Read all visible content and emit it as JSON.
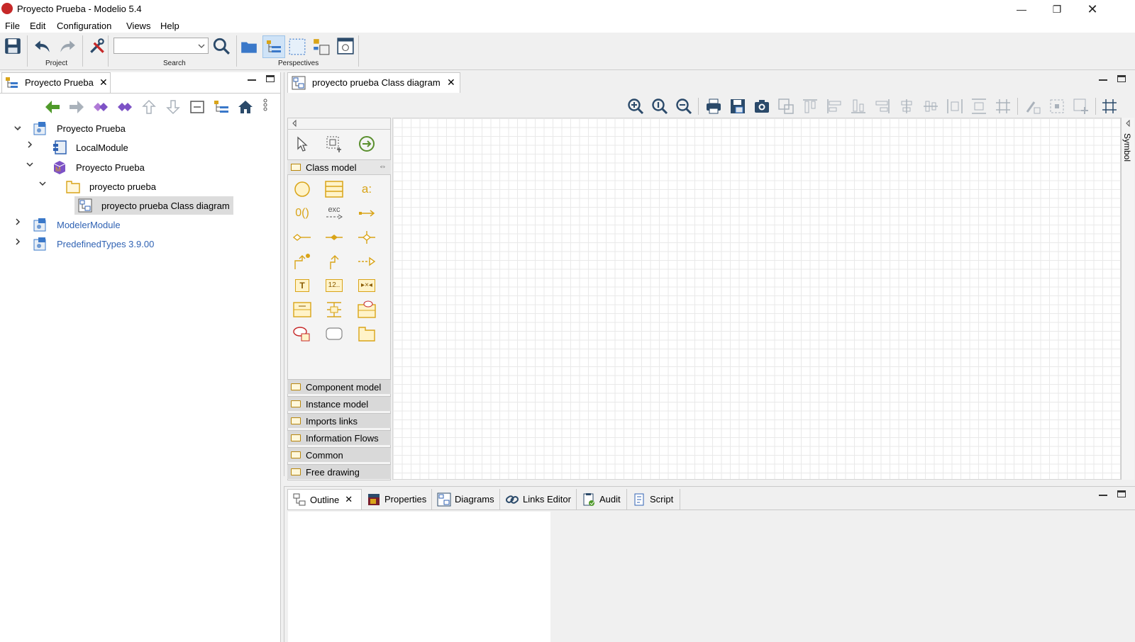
{
  "window": {
    "title": "Proyecto Prueba - Modelio 5.4"
  },
  "menu": [
    "File",
    "Edit",
    "Configuration",
    "Views",
    "Help"
  ],
  "toolbar": {
    "groups": {
      "project": "Project",
      "search": "Search",
      "perspectives": "Perspectives"
    },
    "search_value": ""
  },
  "explorer": {
    "tab_label": "Proyecto Prueba",
    "tree": [
      {
        "label": "Proyecto Prueba",
        "expanded": true
      },
      {
        "label": "LocalModule",
        "expanded": false
      },
      {
        "label": "Proyecto Prueba",
        "expanded": true
      },
      {
        "label": "proyecto prueba",
        "expanded": true
      },
      {
        "label": "proyecto prueba Class diagram",
        "selected": true
      },
      {
        "label": "ModelerModule",
        "expanded": false
      },
      {
        "label": "PredefinedTypes 3.9.00",
        "expanded": false
      }
    ]
  },
  "editor": {
    "tab_label": "proyecto prueba Class diagram",
    "side_label": "Symbol"
  },
  "palette": {
    "open_category": "Class model",
    "categories": [
      "Component model",
      "Instance model",
      "Imports links",
      "Information Flows",
      "Common",
      "Free drawing"
    ],
    "tool_texts": {
      "attribute": "a:",
      "ports": "0()",
      "exception": "exc",
      "text": "T",
      "index": "12..",
      "unknown": "▸×◂"
    }
  },
  "bottom_tabs": [
    "Outline",
    "Properties",
    "Diagrams",
    "Links Editor",
    "Audit",
    "Script"
  ],
  "colors": {
    "accent": "#3a78c9",
    "palette_yellow": "#d9a418",
    "arrow_green": "#5a8f2e",
    "selection": "#dcdcdc",
    "link_blue": "#2f62b3"
  }
}
